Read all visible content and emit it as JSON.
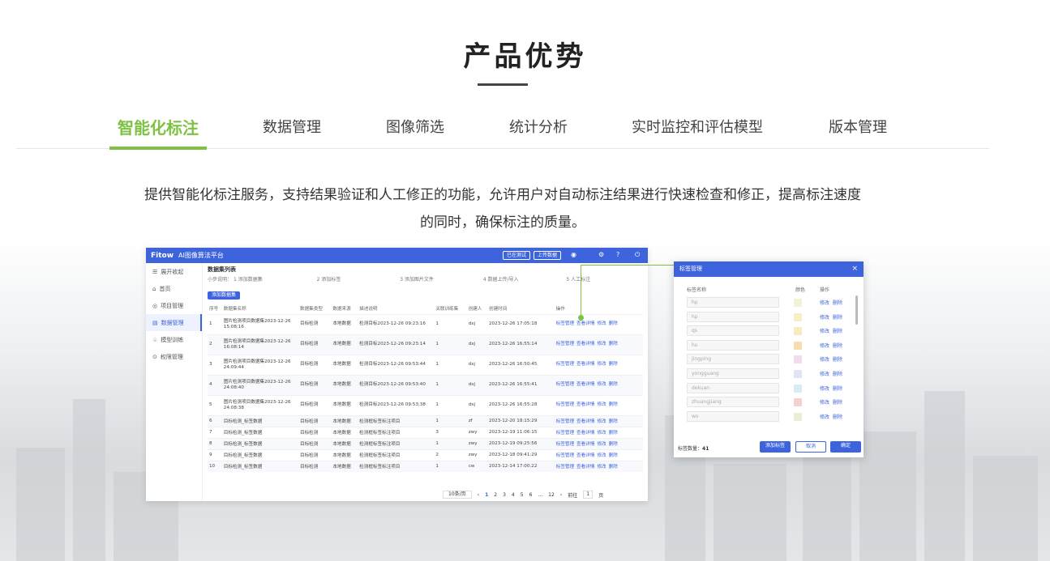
{
  "section_title": "产品优势",
  "tabs": [
    {
      "label": "智能化标注",
      "active": true
    },
    {
      "label": "数据管理"
    },
    {
      "label": "图像筛选"
    },
    {
      "label": "统计分析"
    },
    {
      "label": "实时监控和评估模型"
    },
    {
      "label": "版本管理"
    }
  ],
  "description": "提供智能化标注服务，支持结果验证和人工修正的功能，允许用户对自动标注结果进行快速检查和修正，提高标注速度的同时，确保标注的质量。",
  "app": {
    "logo": "Fitow",
    "platform_title": "AI图像算法平台",
    "header_buttons": [
      "已在测试",
      "上传数据"
    ],
    "sidebar": [
      "展开收起",
      "首页",
      "项目管理",
      "数据管理",
      "模型训练",
      "权限管理"
    ],
    "active_sidebar": 3,
    "breadcrumb": "数据集列表",
    "steps_label": "小步说明：",
    "steps": [
      "1  添加数据集",
      "2  添加标签",
      "3  添加图片文件",
      "4  数据上传/导入",
      "5  人工标注"
    ],
    "add_button": "添加数据集",
    "columns": [
      "序号",
      "数据集名称",
      "数据集类型",
      "数据来源",
      "描述说明",
      "关联训练集",
      "创建人",
      "创建时间",
      "操作"
    ],
    "rows": [
      [
        "1",
        "图片检测项目数据集2023-12-26 15:08:16",
        "目标检测",
        "本地数据",
        "检测目标2023-12-26 09:23:16",
        "1",
        "dxj",
        "2023-12-26 17:05:18"
      ],
      [
        "2",
        "图片检测项目数据集2023-12-26 16:08:14",
        "目标检测",
        "本地数据",
        "检测目标2023-12-26 09:23:14",
        "1",
        "dxj",
        "2023-12-26 16:55:14"
      ],
      [
        "3",
        "图片检测项目数据集2023-12-26 24:09:44",
        "目标检测",
        "本地数据",
        "检测目标2023-12-26 09:53:44",
        "1",
        "dxj",
        "2023-12-26 16:50:45"
      ],
      [
        "4",
        "图片检测项目数据集2023-12-26 24:08:40",
        "目标检测",
        "本地数据",
        "检测目标2023-12-26 09:53:40",
        "1",
        "dxj",
        "2023-12-26 16:55:41"
      ],
      [
        "5",
        "图片检测项目数据集2023-12-26 24:08:38",
        "目标检测",
        "本地数据",
        "检测目标2023-12-26 09:53:38",
        "1",
        "dxj",
        "2023-12-26 16:55:28"
      ],
      [
        "6",
        "目标检测_标签数据",
        "目标检测",
        "本地数据",
        "检测框标签标注项目",
        "1",
        "zf",
        "2023-12-20 18:15:29"
      ],
      [
        "7",
        "目标检测_标签数据",
        "目标检测",
        "本地数据",
        "检测框标签标注项目",
        "3",
        "zwy",
        "2023-12-19 11:06:15"
      ],
      [
        "8",
        "目标检测_标签数据",
        "目标检测",
        "本地数据",
        "检测框标签标注项目",
        "1",
        "zwy",
        "2023-12-19 09:25:56"
      ],
      [
        "9",
        "目标检测_标签数据",
        "目标检测",
        "本地数据",
        "检测框标签标注项目",
        "2",
        "zwy",
        "2023-12-18 09:41:29"
      ],
      [
        "10",
        "目标检测_标签数据",
        "目标检测",
        "本地数据",
        "检测框标签标注项目",
        "1",
        "cw",
        "2023-12-14 17:00:22"
      ]
    ],
    "row_ops": [
      "标签管理",
      "查看详情",
      "修改",
      "删除"
    ],
    "pager": {
      "page_size": "10条/页",
      "pages": [
        "1",
        "2",
        "3",
        "4",
        "5",
        "6",
        "...",
        "12"
      ],
      "current": "1",
      "goto_label": "前往",
      "goto_value": "1",
      "page_unit": "页"
    }
  },
  "dialog": {
    "title": "标签管理",
    "close": "×",
    "col_name": "标签名称",
    "col_color": "颜色",
    "col_ops": "操作",
    "tags": [
      {
        "name": "hp",
        "color": "#f2f2d8"
      },
      {
        "name": "hp",
        "color": "#f7efc6"
      },
      {
        "name": "qs",
        "color": "#f9ebc1"
      },
      {
        "name": "hu",
        "color": "#f9dcb0"
      },
      {
        "name": "jingping",
        "color": "#f1dced"
      },
      {
        "name": "yongguang",
        "color": "#e1e4f4"
      },
      {
        "name": "dekuan",
        "color": "#d9ecf4"
      },
      {
        "name": "zhuangjiang",
        "color": "#f4d2d2"
      },
      {
        "name": "wo",
        "color": "#eaf0d6"
      }
    ],
    "tag_ops": [
      "修改",
      "删除"
    ],
    "count_label": "标签数量：",
    "count_value": "41",
    "btn_add": "添加标签",
    "btn_cancel": "取消",
    "btn_ok": "确定"
  }
}
